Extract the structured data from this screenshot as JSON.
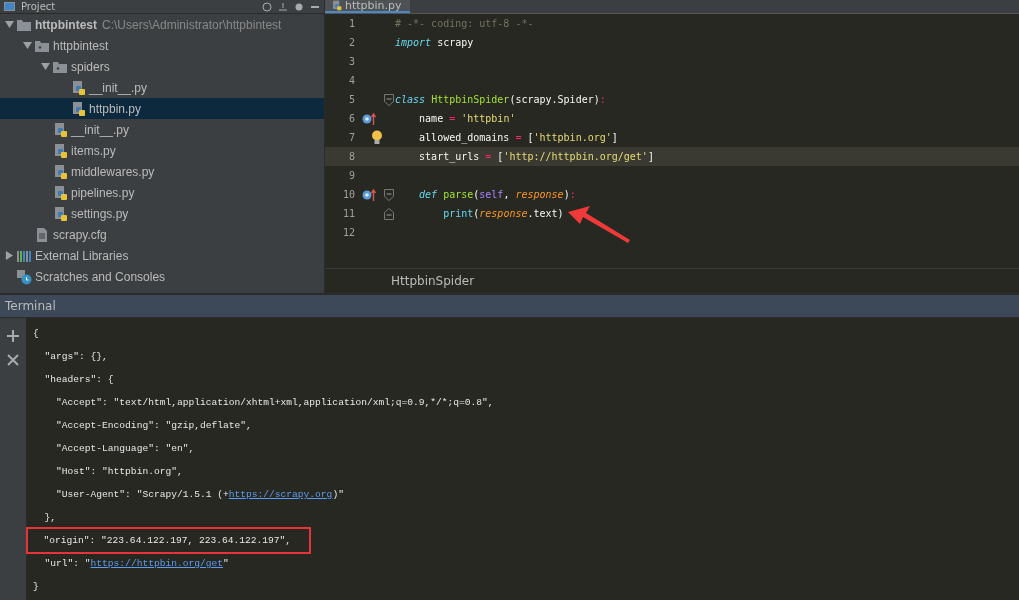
{
  "project_panel": {
    "title": "Project",
    "tree": [
      {
        "label": "httpbintest",
        "path": "C:\\Users\\Administrator\\httpbintest",
        "kind": "folder",
        "expanded": true,
        "selected": false,
        "children": [
          {
            "label": "httpbintest",
            "kind": "package",
            "expanded": true,
            "selected": false,
            "children": [
              {
                "label": "spiders",
                "kind": "package",
                "expanded": true,
                "selected": false,
                "children": [
                  {
                    "label": "__init__.py",
                    "kind": "python",
                    "selected": false
                  },
                  {
                    "label": "httpbin.py",
                    "kind": "python",
                    "selected": true
                  }
                ]
              },
              {
                "label": "__init__.py",
                "kind": "python",
                "selected": false
              },
              {
                "label": "items.py",
                "kind": "python",
                "selected": false
              },
              {
                "label": "middlewares.py",
                "kind": "python",
                "selected": false
              },
              {
                "label": "pipelines.py",
                "kind": "python",
                "selected": false
              },
              {
                "label": "settings.py",
                "kind": "python",
                "selected": false
              }
            ]
          },
          {
            "label": "scrapy.cfg",
            "kind": "config",
            "selected": false
          }
        ]
      },
      {
        "label": "External Libraries",
        "kind": "libraries",
        "expanded": false,
        "selected": false
      },
      {
        "label": "Scratches and Consoles",
        "kind": "scratches",
        "selected": false
      }
    ]
  },
  "editor": {
    "tabs": [
      {
        "label": "httpbin.py",
        "selected": true
      }
    ],
    "lines": [
      {
        "number": "1",
        "current": false,
        "tokens": [
          {
            "text": "# -*- coding: utf-8 -*-",
            "kind": "comment"
          }
        ]
      },
      {
        "number": "2",
        "current": false,
        "tokens": [
          {
            "text": "import ",
            "kind": "keyword"
          },
          {
            "text": "scrapy",
            "kind": "plain"
          }
        ]
      },
      {
        "number": "3",
        "current": false
      },
      {
        "number": "4",
        "current": false
      },
      {
        "number": "5",
        "current": false,
        "fold": {
          "kind": "start"
        },
        "tokens": [
          {
            "text": "class ",
            "kind": "keyword"
          },
          {
            "text": "HttpbinSpider",
            "kind": "name"
          },
          {
            "text": "(scrapy.Spider)",
            "kind": "plain"
          },
          {
            "text": ":",
            "kind": "op"
          }
        ]
      },
      {
        "number": "6",
        "current": false,
        "marker": {
          "kind": "override"
        },
        "tokens": [
          {
            "text": "    name ",
            "kind": "plain"
          },
          {
            "text": "= ",
            "kind": "op"
          },
          {
            "text": "'httpbin'",
            "kind": "string"
          }
        ]
      },
      {
        "number": "7",
        "current": false,
        "marker": {
          "kind": "bulb"
        },
        "tokens": [
          {
            "text": "    allowed_domains ",
            "kind": "plain"
          },
          {
            "text": "= ",
            "kind": "op"
          },
          {
            "text": "[",
            "kind": "plain"
          },
          {
            "text": "'httpbin.org'",
            "kind": "string"
          },
          {
            "text": "]",
            "kind": "plain"
          }
        ]
      },
      {
        "number": "8",
        "current": true,
        "tokens": [
          {
            "text": "    start_urls ",
            "kind": "plain"
          },
          {
            "text": "= ",
            "kind": "op"
          },
          {
            "text": "[",
            "kind": "plain"
          },
          {
            "text": "'http://httpbin.org/get'",
            "kind": "string"
          },
          {
            "text": "]",
            "kind": "plain"
          }
        ]
      },
      {
        "number": "9",
        "current": false
      },
      {
        "number": "10",
        "current": false,
        "marker": {
          "kind": "override"
        },
        "fold": {
          "kind": "start"
        },
        "tokens": [
          {
            "text": "    def ",
            "kind": "keyword"
          },
          {
            "text": "parse",
            "kind": "name"
          },
          {
            "text": "(",
            "kind": "plain"
          },
          {
            "text": "self",
            "kind": "self"
          },
          {
            "text": ", ",
            "kind": "plain"
          },
          {
            "text": "response",
            "kind": "param"
          },
          {
            "text": ")",
            "kind": "plain"
          },
          {
            "text": ":",
            "kind": "op"
          }
        ]
      },
      {
        "number": "11",
        "current": false,
        "fold": {
          "kind": "end"
        },
        "annotation": {
          "kind": "arrow"
        },
        "tokens": [
          {
            "text": "        print",
            "kind": "builtin"
          },
          {
            "text": "(",
            "kind": "plain"
          },
          {
            "text": "response",
            "kind": "param"
          },
          {
            "text": ".text)",
            "kind": "plain"
          }
        ]
      },
      {
        "number": "12",
        "current": false
      }
    ],
    "breadcrumb": "HttpbinSpider"
  },
  "terminal": {
    "title": "Terminal",
    "lines": [
      {
        "boxed": false,
        "tokens": [
          {
            "text": "{",
            "kind": "text"
          }
        ]
      },
      {
        "boxed": false,
        "tokens": [
          {
            "text": "  \"args\": {},",
            "kind": "text"
          }
        ]
      },
      {
        "boxed": false,
        "tokens": [
          {
            "text": "  \"headers\": {",
            "kind": "text"
          }
        ]
      },
      {
        "boxed": false,
        "tokens": [
          {
            "text": "    \"Accept\": \"text/html,application/xhtml+xml,application/xml;q=0.9,*/*;q=0.8\",",
            "kind": "text"
          }
        ]
      },
      {
        "boxed": false,
        "tokens": [
          {
            "text": "    \"Accept-Encoding\": \"gzip,deflate\",",
            "kind": "text"
          }
        ]
      },
      {
        "boxed": false,
        "tokens": [
          {
            "text": "    \"Accept-Language\": \"en\",",
            "kind": "text"
          }
        ]
      },
      {
        "boxed": false,
        "tokens": [
          {
            "text": "    \"Host\": \"httpbin.org\",",
            "kind": "text"
          }
        ]
      },
      {
        "boxed": false,
        "tokens": [
          {
            "text": "    \"User-Agent\": \"Scrapy/1.5.1 (+",
            "kind": "text"
          },
          {
            "text": "https://scrapy.org",
            "kind": "link"
          },
          {
            "text": ")\"",
            "kind": "text"
          }
        ]
      },
      {
        "boxed": false,
        "tokens": [
          {
            "text": "  },",
            "kind": "text"
          }
        ]
      },
      {
        "boxed": true,
        "tokens": [
          {
            "text": "  \"origin\": \"223.64.122.197, 223.64.122.197\",",
            "kind": "text"
          }
        ]
      },
      {
        "boxed": false,
        "tokens": [
          {
            "text": "  \"url\": \"",
            "kind": "text"
          },
          {
            "text": "https://httpbin.org/get",
            "kind": "link"
          },
          {
            "text": "\"",
            "kind": "text"
          }
        ]
      },
      {
        "boxed": false,
        "tokens": [
          {
            "text": "}",
            "kind": "text"
          }
        ]
      }
    ]
  }
}
